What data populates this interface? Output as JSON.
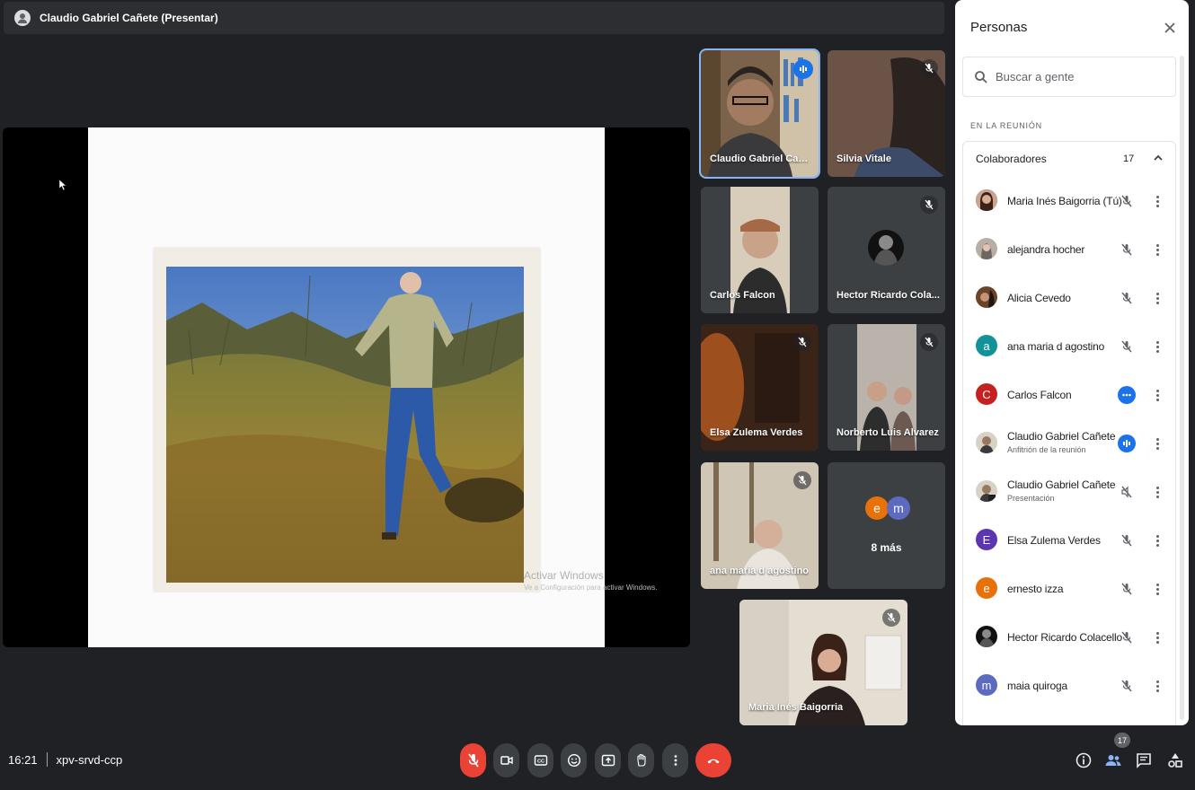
{
  "presenter_bar": {
    "title": "Claudio Gabriel Cañete (Presentar)"
  },
  "screen_share": {
    "watermark_title": "Activar Windows",
    "watermark_sub": "Ve a Configuración para activar Windows."
  },
  "tiles": [
    {
      "name": "Claudio Gabriel Cañe...",
      "speaking": true
    },
    {
      "name": "Silvia Vitale",
      "muted": true
    },
    {
      "name": "Carlos Falcon"
    },
    {
      "name": "Hector Ricardo Cola...",
      "muted": true
    },
    {
      "name": "Elsa Zulema Verdes",
      "muted": true
    },
    {
      "name": "Norberto Luis Alvarez",
      "muted": true
    },
    {
      "name": "ana maria d agostino",
      "muted": true
    },
    {
      "more_label": "8 más",
      "avatars": [
        {
          "letter": "e",
          "color": "#e8710a"
        },
        {
          "letter": "m",
          "color": "#5c6bc0"
        }
      ]
    },
    {
      "name": "Maria Inés Baigorria",
      "muted": true
    }
  ],
  "panel": {
    "title": "Personas",
    "search_placeholder": "Buscar a gente",
    "section_label": "EN LA REUNIÓN",
    "group": {
      "label": "Colaboradores",
      "count": "17"
    },
    "people": [
      {
        "name": "Maria Inés Baigorria (Tú)",
        "status": "muted",
        "avatar": "photo"
      },
      {
        "name": "alejandra hocher",
        "status": "muted",
        "avatar": "photo"
      },
      {
        "name": "Alicia Cevedo",
        "status": "muted",
        "avatar": "photo"
      },
      {
        "name": "ana maria d agostino",
        "status": "muted",
        "avatar_letter": "a",
        "avatar_color": "#12939a"
      },
      {
        "name": "Carlos Falcon",
        "status": "more-dots",
        "avatar_letter": "C",
        "avatar_color": "#c5221f"
      },
      {
        "name": "Claudio Gabriel Cañete",
        "sub": "Anfitrión de la reunión",
        "status": "speaking",
        "avatar": "photo"
      },
      {
        "name": "Claudio Gabriel Cañete",
        "sub": "Presentación",
        "status": "muted-outline",
        "avatar": "photo"
      },
      {
        "name": "Elsa Zulema Verdes",
        "status": "muted",
        "avatar_letter": "E",
        "avatar_color": "#5e35b1"
      },
      {
        "name": "ernesto izza",
        "status": "muted",
        "avatar_letter": "e",
        "avatar_color": "#e8710a"
      },
      {
        "name": "Hector Ricardo Colacello",
        "status": "muted",
        "avatar": "photo"
      },
      {
        "name": "maia quiroga",
        "status": "muted",
        "avatar_letter": "m",
        "avatar_color": "#5c6bc0"
      }
    ]
  },
  "bottom": {
    "time": "16:21",
    "meeting_code": "xpv-srvd-ccp",
    "people_count": "17"
  },
  "colors": {
    "accent": "#1a73e8",
    "hangup": "#ea4335",
    "bg": "#202124"
  }
}
